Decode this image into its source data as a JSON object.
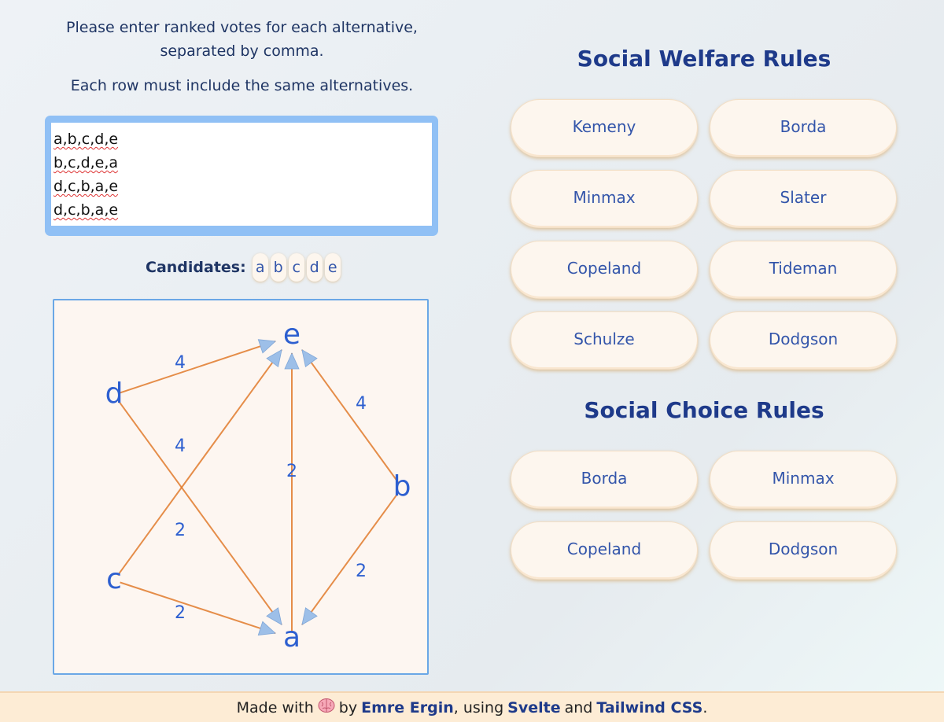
{
  "input": {
    "instruction_line": "Please enter ranked votes for each alternative, separated by comma.",
    "instruction_2": "Each row must include the same alternatives.",
    "votes": [
      "a,b,c,d,e",
      "b,c,d,e,a",
      "d,c,b,a,e",
      "d,c,b,a,e"
    ]
  },
  "candidates": {
    "label": "Candidates:",
    "items": [
      "a",
      "b",
      "c",
      "d",
      "e"
    ]
  },
  "graph": {
    "nodes": [
      {
        "id": "e",
        "label": "e"
      },
      {
        "id": "d",
        "label": "d"
      },
      {
        "id": "b",
        "label": "b"
      },
      {
        "id": "c",
        "label": "c"
      },
      {
        "id": "a",
        "label": "a"
      }
    ],
    "edges": [
      {
        "from": "d",
        "to": "e",
        "weight": "4"
      },
      {
        "from": "b",
        "to": "e",
        "weight": "4"
      },
      {
        "from": "d",
        "to": "a",
        "weight": "4"
      },
      {
        "from": "a",
        "to": "e",
        "weight": "2"
      },
      {
        "from": "c",
        "to": "e",
        "weight": "2"
      },
      {
        "from": "b",
        "to": "a",
        "weight": "2"
      },
      {
        "from": "c",
        "to": "a",
        "weight": "2"
      }
    ]
  },
  "welfare": {
    "title": "Social Welfare Rules",
    "rules": [
      "Kemeny",
      "Borda",
      "Minmax",
      "Slater",
      "Copeland",
      "Tideman",
      "Schulze",
      "Dodgson"
    ]
  },
  "choice": {
    "title": "Social Choice Rules",
    "rules": [
      "Borda",
      "Minmax",
      "Copeland",
      "Dodgson"
    ]
  },
  "footer": {
    "made_with": "Made with",
    "brain_icon": "brain-icon",
    "by": "by",
    "author": "Emre Ergin",
    "using": ", using",
    "framework": "Svelte",
    "and": "and",
    "css": "Tailwind CSS",
    "period": "."
  },
  "colors": {
    "edge": "#e07a2c",
    "arrow": "#9dbfe8",
    "node_text": "#2d5fd0",
    "title": "#1e3a8a"
  }
}
